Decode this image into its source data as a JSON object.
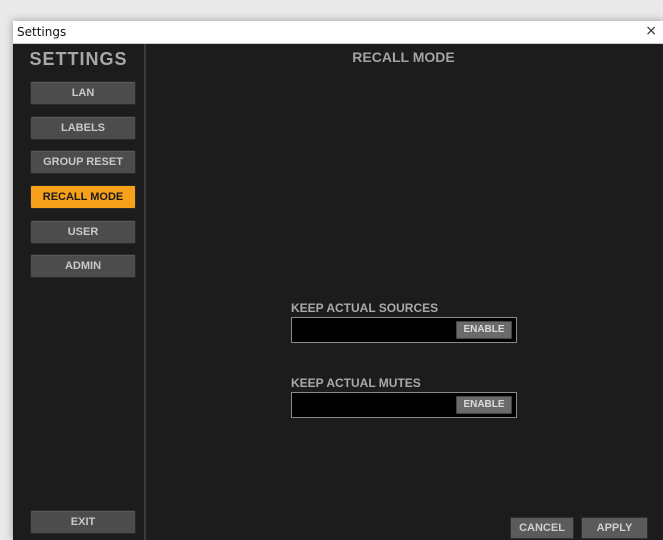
{
  "window": {
    "title": "Settings",
    "close_glyph": "×"
  },
  "sidebar": {
    "title": "SETTINGS",
    "items": [
      {
        "label": "LAN"
      },
      {
        "label": "LABELS"
      },
      {
        "label": "GROUP RESET"
      },
      {
        "label": "RECALL MODE",
        "active": true
      },
      {
        "label": "USER"
      },
      {
        "label": "ADMIN"
      }
    ],
    "exit_label": "EXIT"
  },
  "main": {
    "title": "RECALL MODE",
    "options": [
      {
        "label": "KEEP ACTUAL SOURCES",
        "button": "ENABLE"
      },
      {
        "label": "KEEP ACTUAL MUTES",
        "button": "ENABLE"
      }
    ]
  },
  "footer": {
    "cancel_label": "CANCEL",
    "apply_label": "APPLY"
  },
  "colors": {
    "accent": "#f7a11a",
    "background": "#1c1c1c",
    "button": "#4c4c4c"
  }
}
